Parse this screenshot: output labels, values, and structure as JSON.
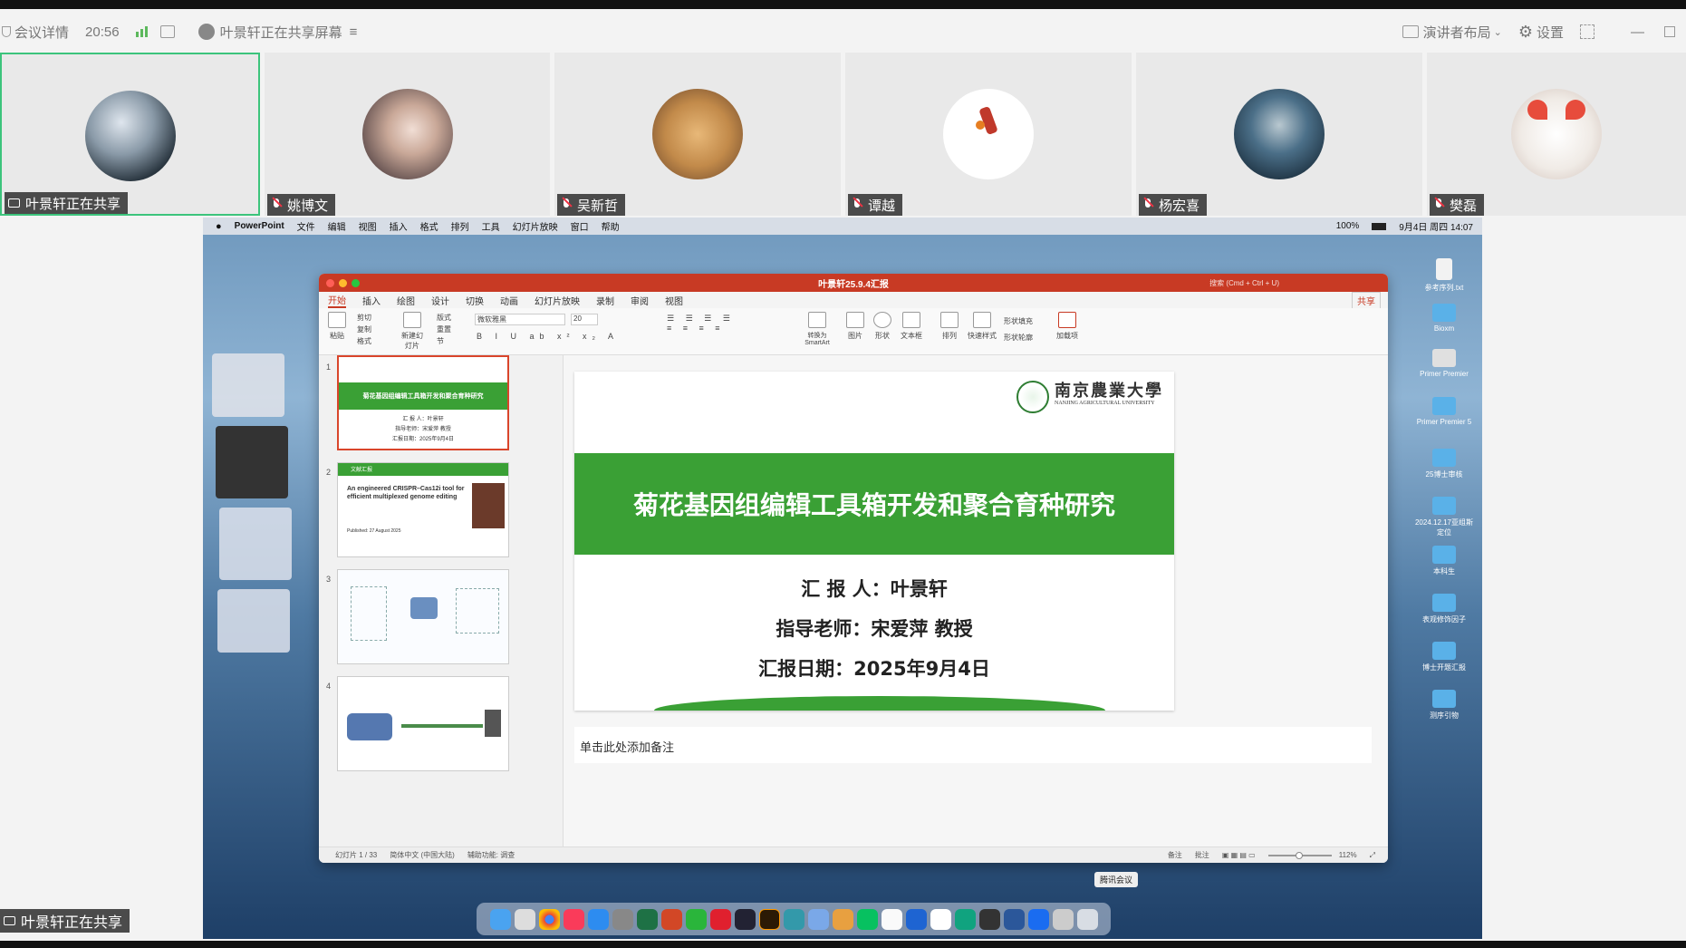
{
  "meeting_bar": {
    "details": "会议详情",
    "time": "20:56",
    "sharing_status": "叶景轩正在共享屏幕",
    "layout": "演讲者布局",
    "settings": "设置"
  },
  "participants": [
    {
      "name": "叶景轩正在共享",
      "color": "#3b4a55",
      "active": true
    },
    {
      "name": "姚博文",
      "color": "#c9a898"
    },
    {
      "name": "吴新哲",
      "color": "#c28a4a"
    },
    {
      "name": "谭越",
      "color": "#ffffff"
    },
    {
      "name": "杨宏喜",
      "color": "#223e55"
    },
    {
      "name": "樊磊",
      "color": "#f0ebe6"
    }
  ],
  "mac_menubar": {
    "app": "PowerPoint",
    "menus": [
      "文件",
      "编辑",
      "视图",
      "插入",
      "格式",
      "排列",
      "工具",
      "幻灯片放映",
      "窗口",
      "帮助"
    ],
    "battery": "100%",
    "datetime": "9月4日 周四 14:07"
  },
  "ppt": {
    "title": "叶景轩25.9.4汇报",
    "search": "搜索 (Cmd + Ctrl + U)",
    "tabs": [
      "开始",
      "插入",
      "绘图",
      "设计",
      "切换",
      "动画",
      "幻灯片放映",
      "录制",
      "审阅",
      "视图"
    ],
    "share": "共享",
    "ribbon": {
      "paste": "粘贴",
      "cut": "剪切",
      "copy": "复制",
      "format": "格式",
      "new_slide": "新建幻灯片",
      "layout": "版式",
      "reset": "重置",
      "section": "节",
      "font": "微软雅黑",
      "size": "20",
      "smartart": "转换为SmartArt",
      "picture": "图片",
      "shape": "形状",
      "textbox": "文本框",
      "arrange": "排列",
      "quickstyle": "快速样式",
      "fill": "形状填充",
      "outline": "形状轮廓",
      "addins": "加载项"
    },
    "thumbs": [
      {
        "num": "1",
        "title": "菊花基因组编辑工具箱开发和聚合育种研究",
        "l1": "汇 报 人：叶景轩",
        "l2": "指导老师：宋爱萍 教授",
        "l3": "汇报日期：2025年9月4日"
      },
      {
        "num": "2",
        "header": "文献汇报",
        "title": "An engineered CRISPR–Cas12i tool for efficient multiplexed genome editing",
        "published": "Published: 27 August 2025"
      },
      {
        "num": "3"
      },
      {
        "num": "4"
      }
    ],
    "slide": {
      "university_cn": "南京農業大學",
      "university_en": "NANJING AGRICULTURAL UNIVERSITY",
      "title": "菊花基因组编辑工具箱开发和聚合育种研究",
      "reporter": "汇  报  人：叶景轩",
      "advisor": "指导老师：宋爱萍  教授",
      "date": "汇报日期：2025年9月4日"
    },
    "notes_placeholder": "单击此处添加备注",
    "status": {
      "slide": "幻灯片 1 / 33",
      "lang": "简体中文 (中国大陆)",
      "a11y": "辅助功能: 调查",
      "notes": "备注",
      "comments": "批注",
      "zoom": "112%"
    }
  },
  "desktop_icons": [
    "参考序列.txt",
    "Bioxm",
    "Primer Premier",
    "Primer Premier 5",
    "25博士审核",
    "2024.12.17亚组斯定位",
    "本科生",
    "表观修饰因子",
    "博士开题汇报",
    "测序引物"
  ],
  "tooltip": "腾讯会议",
  "bottom_share_label": "叶景轩正在共享"
}
